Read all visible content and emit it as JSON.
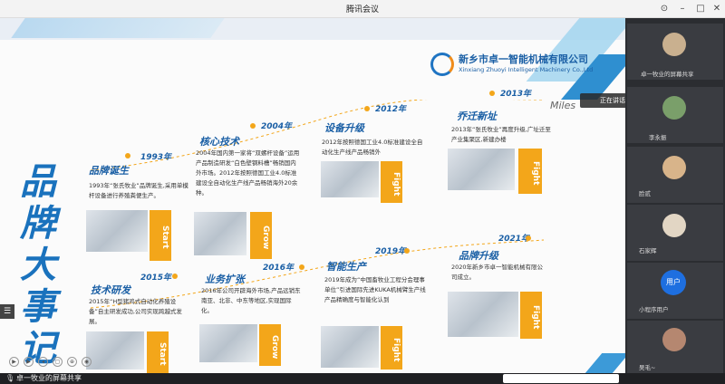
{
  "window": {
    "title": "腾讯会议"
  },
  "slide": {
    "company_cn": "新乡市卓一智能机械有限公司",
    "company_en": "Xinxiang Zhuoyi Intelligent Machinery Co.,Ltd",
    "milestone_word": "Miles",
    "vertical_title": "品牌大事记",
    "events": [
      {
        "year": "1993年",
        "title": "品牌诞生",
        "text": "1993年“张氏牧业”品牌诞生,采用单模杆设备进行养殖粪便生产。",
        "tag": "Start"
      },
      {
        "year": "2004年",
        "title": "核心技术",
        "text": "2004年国内第一家将“双螺杆设备”运用产品制造研发“白色壁钢料槽”畅销国内外市场。2012年按照德国工业4.0标准建设全自动化生产线产品畅销海外20余种。",
        "tag": "Grow"
      },
      {
        "year": "2012年",
        "title": "设备升级",
        "text": "2012年按照德国工业4.0标准建设全自动化生产线产品畅销外",
        "tag": "Fight"
      },
      {
        "year": "2013年",
        "title": "乔迁新址",
        "text": "2013年“张氏牧业”再度升级,广址迁至产业集聚区,新建办楼",
        "tag": "Fight"
      },
      {
        "year": "2015年",
        "title": "技术研发",
        "text": "2015年“H型猪鸡式自动化养殖设备”自主研发成功,公司实现跨越式发展。",
        "tag": "Start"
      },
      {
        "year": "2016年",
        "title": "业务扩张",
        "text": "2016年公司开辟海外市场,产品远销东南亚、北非、中东等地区,实现国际化。",
        "tag": "Grow"
      },
      {
        "year": "2019年",
        "title": "智能生产",
        "text": "2019年成为“中国畜牧业工程分会理事单位”引进国际先进KUKA机械臂生产线产品精确度与智能化认到",
        "tag": "Fight"
      },
      {
        "year": "2021年",
        "title": "品牌升级",
        "text": "2020年新乡市卓一智能机械有限公司成立。",
        "tag": "Fight"
      }
    ]
  },
  "speaking": "正在讲话: 卓一牧业;",
  "participants": [
    {
      "name": "卓一牧业的屏幕共享",
      "avatar_color": "#c9b08f"
    },
    {
      "name": "李永振",
      "avatar_color": "#7a9f6a"
    },
    {
      "name": "脸贰",
      "avatar_color": "#d8b48a"
    },
    {
      "name": "石家辉",
      "avatar_color": "#e2d6c4"
    },
    {
      "name": "小程序用户",
      "avatar_text": "用户",
      "avatar_color": "#1e6fe0"
    },
    {
      "name": "吴毛~",
      "avatar_color": "#b58770"
    }
  ],
  "bottom": {
    "share_label": "卓一牧业的屏幕共享"
  },
  "toolbar_icons": [
    "play-icon",
    "pause-icon",
    "cursor-icon",
    "fullscreen-icon",
    "zoom-icon",
    "eye-icon"
  ],
  "side_handle": "☰"
}
